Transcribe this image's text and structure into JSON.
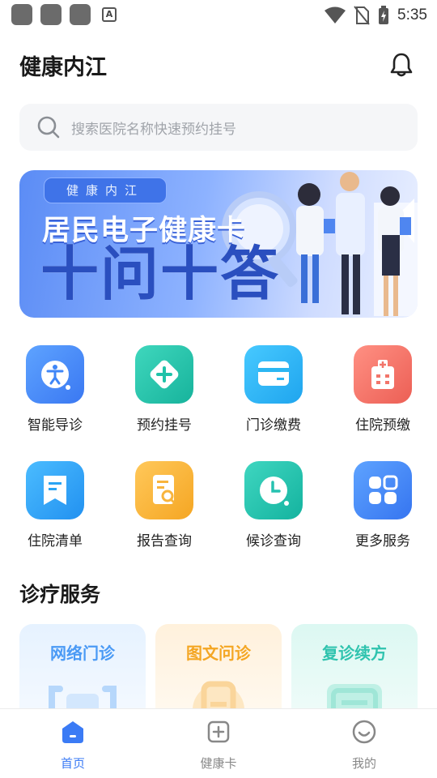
{
  "status_bar": {
    "time": "5:35"
  },
  "header": {
    "title": "健康内江"
  },
  "search": {
    "placeholder": "搜索医院名称快速预约挂号"
  },
  "banner": {
    "tag": "健康内江",
    "headline": "居民电子健康卡",
    "subheadline": "十问十答"
  },
  "quick_services": [
    {
      "label": "智能导诊",
      "icon": "accessibility-icon",
      "color": "#3f86f7"
    },
    {
      "label": "预约挂号",
      "icon": "plus-diamond-icon",
      "color": "#1fc2a8"
    },
    {
      "label": "门诊缴费",
      "icon": "card-icon",
      "color": "#2bb6f2"
    },
    {
      "label": "住院预缴",
      "icon": "hospital-icon",
      "color": "#f2756a"
    },
    {
      "label": "住院清单",
      "icon": "list-flag-icon",
      "color": "#2aa4f4"
    },
    {
      "label": "报告查询",
      "icon": "report-search-icon",
      "color": "#f8b43c"
    },
    {
      "label": "候诊查询",
      "icon": "clock-icon",
      "color": "#26c2b0"
    },
    {
      "label": "更多服务",
      "icon": "grid-icon",
      "color": "#3e86f6"
    }
  ],
  "section": {
    "title": "诊疗服务"
  },
  "clinic_services": [
    {
      "label": "网络门诊",
      "color": "#4a9af5"
    },
    {
      "label": "图文问诊",
      "color": "#f4a623"
    },
    {
      "label": "复诊续方",
      "color": "#2fc3ae"
    }
  ],
  "bottom_nav": [
    {
      "label": "首页",
      "active": true
    },
    {
      "label": "健康卡",
      "active": false
    },
    {
      "label": "我的",
      "active": false
    }
  ]
}
